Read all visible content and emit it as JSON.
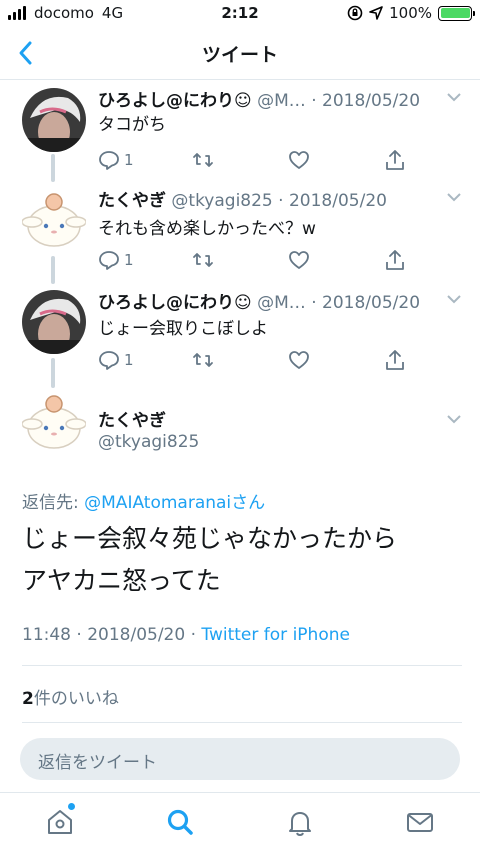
{
  "status_bar": {
    "carrier": "docomo",
    "network": "4G",
    "time": "2:12",
    "battery": "100%"
  },
  "nav": {
    "title": "ツイート"
  },
  "thread": [
    {
      "name": "ひろよし@にわり☺",
      "handle": "@M…",
      "date": "· 2018/05/20",
      "text": "タコがち",
      "reply_count": "1"
    },
    {
      "name": "たくやぎ",
      "handle": "@tkyagi825",
      "date": "· 2018/05/20",
      "text": "それも含め楽しかったべ？w",
      "reply_count": "1"
    },
    {
      "name": "ひろよし@にわり☺",
      "handle": "@M…",
      "date": "· 2018/05/20",
      "text": "じょー会取りこぼしよ",
      "reply_count": "1"
    }
  ],
  "main_tweet": {
    "name": "たくやぎ",
    "handle": "@tkyagi825",
    "reply_prefix": "返信先: ",
    "reply_link": "@MAIAtomaranai",
    "reply_suffix": "さん",
    "text_line1": "じょー会叙々苑じゃなかったから",
    "text_line2": "アヤカニ怒ってた",
    "time": "11:48 · 2018/05/20 · ",
    "source": "Twitter for iPhone",
    "like_count": "2",
    "like_label": "件のいいね"
  },
  "reply_box": {
    "placeholder": "返信をツイート"
  },
  "colors": {
    "accent": "#1da1f2",
    "battery": "#4cd964",
    "muted": "#657786",
    "divider": "#e1e8ed"
  }
}
